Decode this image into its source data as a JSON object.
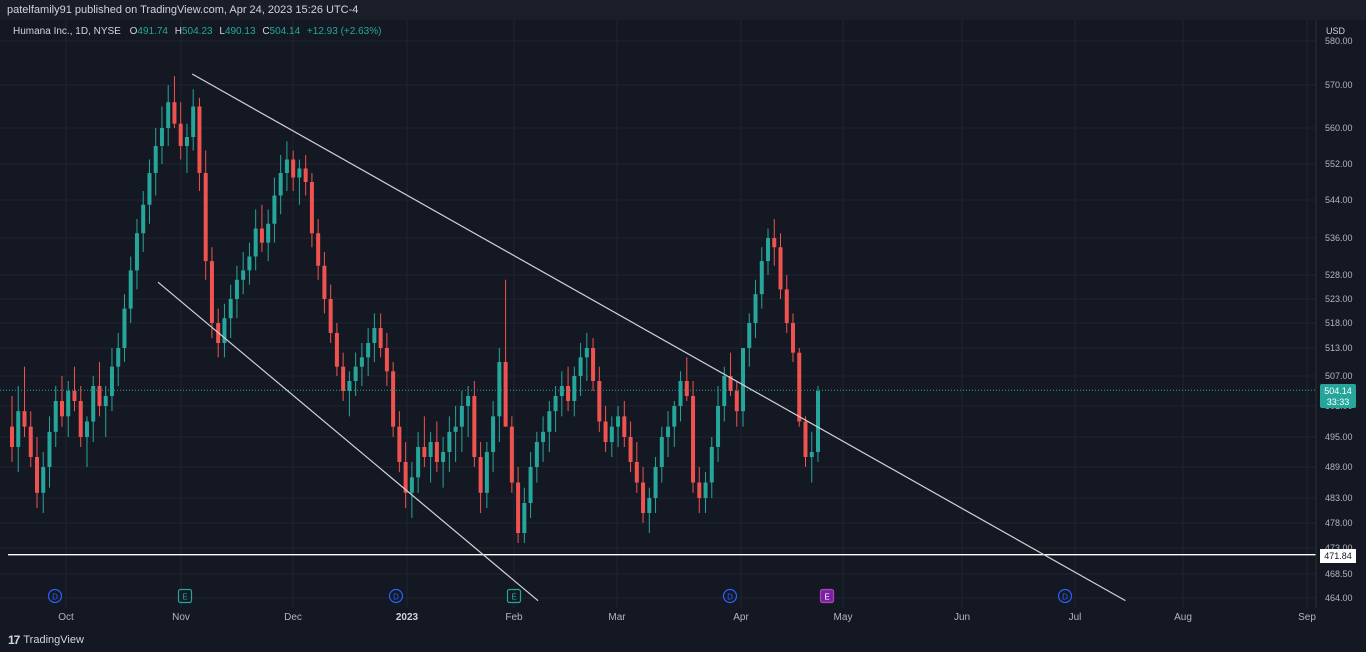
{
  "header": {
    "published_text": "patelfamily91 published on TradingView.com, Apr 24, 2023 15:26 UTC-4"
  },
  "symbol_line": {
    "name": "Humana Inc., 1D, NYSE",
    "open_label": "O",
    "open": "491.74",
    "high_label": "H",
    "high": "504.23",
    "low_label": "L",
    "low": "490.13",
    "close_label": "C",
    "close": "504.14",
    "change": "+12.93 (+2.63%)"
  },
  "currency": "USD",
  "price_badge": {
    "price": "504.14",
    "countdown": "33:33"
  },
  "level_badge": "471.84",
  "footer": {
    "brand": "TradingView"
  },
  "colors": {
    "up": "#26a69a",
    "down": "#ef5350",
    "background": "#141823",
    "line": "#d1d4dc"
  },
  "chart_data": {
    "type": "candlestick",
    "title": "Humana Inc., 1D, NYSE",
    "y_ticks": [
      "580.00",
      "570.00",
      "560.00",
      "552.00",
      "544.00",
      "536.00",
      "528.00",
      "523.00",
      "518.00",
      "513.00",
      "507.00",
      "501.00",
      "495.00",
      "489.00",
      "483.00",
      "478.00",
      "473.00",
      "468.50",
      "464.00"
    ],
    "x_ticks": [
      "Oct",
      "Nov",
      "Dec",
      "2023",
      "Feb",
      "Mar",
      "Apr",
      "May",
      "Jun",
      "Jul",
      "Aug",
      "Sep"
    ],
    "last_price": 504.14,
    "horizontal_line": 471.84,
    "trendlines": [
      {
        "from": {
          "date": "2022-11-04",
          "price": 572.5
        },
        "to": {
          "date": "2023-07-15",
          "price": 463.5
        }
      },
      {
        "from": {
          "date": "2022-10-25",
          "price": 526.5
        },
        "to": {
          "date": "2023-02-08",
          "price": 463.5
        }
      }
    ],
    "events": [
      {
        "type": "D",
        "date": "Sep"
      },
      {
        "type": "E",
        "date": "Nov"
      },
      {
        "type": "D",
        "date": "Dec"
      },
      {
        "type": "E",
        "date": "Jan"
      },
      {
        "type": "D",
        "date": "Mar"
      },
      {
        "type": "E",
        "date": "Apr",
        "highlight": true
      },
      {
        "type": "D",
        "date": "Jun"
      }
    ],
    "points": [
      [
        497,
        503,
        490,
        493
      ],
      [
        493,
        505,
        488,
        500
      ],
      [
        500,
        509,
        495,
        497
      ],
      [
        497,
        500,
        489,
        491
      ],
      [
        491,
        495,
        481,
        484
      ],
      [
        484,
        492,
        480,
        489
      ],
      [
        489,
        499,
        485,
        496
      ],
      [
        496,
        505,
        493,
        502
      ],
      [
        502,
        507,
        497,
        499
      ],
      [
        499,
        506,
        495,
        504
      ],
      [
        504,
        509,
        500,
        502
      ],
      [
        502,
        505,
        493,
        495
      ],
      [
        495,
        499,
        489,
        498
      ],
      [
        498,
        507,
        494,
        505
      ],
      [
        505,
        510,
        499,
        501
      ],
      [
        501,
        505,
        495,
        503
      ],
      [
        503,
        513,
        500,
        509
      ],
      [
        509,
        516,
        505,
        513
      ],
      [
        513,
        524,
        510,
        521
      ],
      [
        521,
        532,
        518,
        529
      ],
      [
        529,
        540,
        525,
        537
      ],
      [
        537,
        546,
        533,
        543
      ],
      [
        543,
        553,
        539,
        550
      ],
      [
        550,
        560,
        545,
        556
      ],
      [
        556,
        565,
        552,
        560
      ],
      [
        560,
        570,
        556,
        566
      ],
      [
        566,
        572,
        560,
        561
      ],
      [
        561,
        566,
        553,
        556
      ],
      [
        556,
        561,
        550,
        558
      ],
      [
        558,
        569,
        555,
        565
      ],
      [
        565,
        567,
        546,
        550
      ],
      [
        550,
        555,
        527,
        531
      ],
      [
        531,
        534,
        515,
        518
      ],
      [
        518,
        521,
        511,
        514
      ],
      [
        514,
        522,
        511,
        519
      ],
      [
        519,
        526,
        515,
        523
      ],
      [
        523,
        530,
        519,
        527
      ],
      [
        527,
        533,
        524,
        529
      ],
      [
        529,
        535,
        526,
        532
      ],
      [
        532,
        542,
        529,
        538
      ],
      [
        538,
        543,
        533,
        535
      ],
      [
        535,
        542,
        531,
        539
      ],
      [
        539,
        549,
        535,
        545
      ],
      [
        545,
        554,
        541,
        550
      ],
      [
        550,
        557,
        546,
        553
      ],
      [
        553,
        555,
        546,
        549
      ],
      [
        549,
        553,
        543,
        551
      ],
      [
        551,
        554,
        545,
        548
      ],
      [
        548,
        550,
        534,
        537
      ],
      [
        537,
        540,
        527,
        530
      ],
      [
        530,
        533,
        520,
        523
      ],
      [
        523,
        526,
        514,
        516
      ],
      [
        516,
        518,
        507,
        509
      ],
      [
        509,
        512,
        502,
        504
      ],
      [
        504,
        508,
        499,
        506
      ],
      [
        506,
        512,
        503,
        509
      ],
      [
        509,
        514,
        505,
        511
      ],
      [
        511,
        517,
        507,
        514
      ],
      [
        514,
        520,
        510,
        517
      ],
      [
        517,
        520,
        511,
        513
      ],
      [
        513,
        516,
        505,
        508
      ],
      [
        508,
        510,
        495,
        497
      ],
      [
        497,
        500,
        488,
        490
      ],
      [
        490,
        494,
        481,
        484
      ],
      [
        484,
        490,
        479,
        487
      ],
      [
        487,
        496,
        484,
        493
      ],
      [
        493,
        499,
        489,
        491
      ],
      [
        491,
        496,
        486,
        494
      ],
      [
        494,
        498,
        488,
        490
      ],
      [
        490,
        495,
        485,
        492
      ],
      [
        492,
        499,
        488,
        496
      ],
      [
        496,
        501,
        490,
        497
      ],
      [
        497,
        504,
        492,
        501
      ],
      [
        501,
        505,
        495,
        503
      ],
      [
        503,
        506,
        489,
        491
      ],
      [
        491,
        494,
        480,
        484
      ],
      [
        484,
        494,
        481,
        492
      ],
      [
        492,
        502,
        488,
        499
      ],
      [
        499,
        513,
        494,
        510
      ],
      [
        510,
        527,
        500,
        497
      ],
      [
        497,
        499,
        484,
        486
      ],
      [
        486,
        489,
        474,
        476
      ],
      [
        476,
        485,
        474,
        482
      ],
      [
        482,
        492,
        479,
        489
      ],
      [
        489,
        496,
        486,
        494
      ],
      [
        494,
        499,
        490,
        496
      ],
      [
        496,
        502,
        492,
        500
      ],
      [
        500,
        505,
        496,
        503
      ],
      [
        503,
        508,
        499,
        505
      ],
      [
        505,
        509,
        500,
        502
      ],
      [
        502,
        509,
        499,
        507
      ],
      [
        507,
        514,
        503,
        511
      ],
      [
        511,
        516,
        506,
        513
      ],
      [
        513,
        515,
        504,
        506
      ],
      [
        506,
        509,
        496,
        498
      ],
      [
        498,
        501,
        492,
        494
      ],
      [
        494,
        499,
        491,
        497
      ],
      [
        497,
        501,
        493,
        499
      ],
      [
        499,
        502,
        493,
        495
      ],
      [
        495,
        498,
        488,
        490
      ],
      [
        490,
        494,
        484,
        486
      ],
      [
        486,
        489,
        478,
        480
      ],
      [
        480,
        485,
        476,
        483
      ],
      [
        483,
        491,
        480,
        489
      ],
      [
        489,
        497,
        486,
        495
      ],
      [
        495,
        500,
        491,
        497
      ],
      [
        497,
        502,
        493,
        501
      ],
      [
        501,
        508,
        498,
        506
      ],
      [
        506,
        511,
        502,
        503
      ],
      [
        503,
        506,
        484,
        486
      ],
      [
        486,
        489,
        480,
        483
      ],
      [
        483,
        488,
        480,
        486
      ],
      [
        486,
        495,
        483,
        493
      ],
      [
        493,
        505,
        490,
        501
      ],
      [
        501,
        509,
        498,
        507
      ],
      [
        507,
        512,
        503,
        504
      ],
      [
        504,
        506,
        497,
        500
      ],
      [
        500,
        509,
        497,
        513
      ],
      [
        513,
        520,
        509,
        518
      ],
      [
        518,
        527,
        515,
        524
      ],
      [
        524,
        534,
        521,
        531
      ],
      [
        531,
        538,
        528,
        536
      ],
      [
        536,
        540,
        530,
        534
      ],
      [
        534,
        537,
        523,
        525
      ],
      [
        525,
        528,
        516,
        518
      ],
      [
        518,
        520,
        510,
        512
      ],
      [
        512,
        513,
        497,
        498
      ],
      [
        498,
        499,
        489,
        491
      ],
      [
        491,
        496,
        486,
        492
      ],
      [
        492,
        505,
        490,
        504
      ]
    ]
  }
}
